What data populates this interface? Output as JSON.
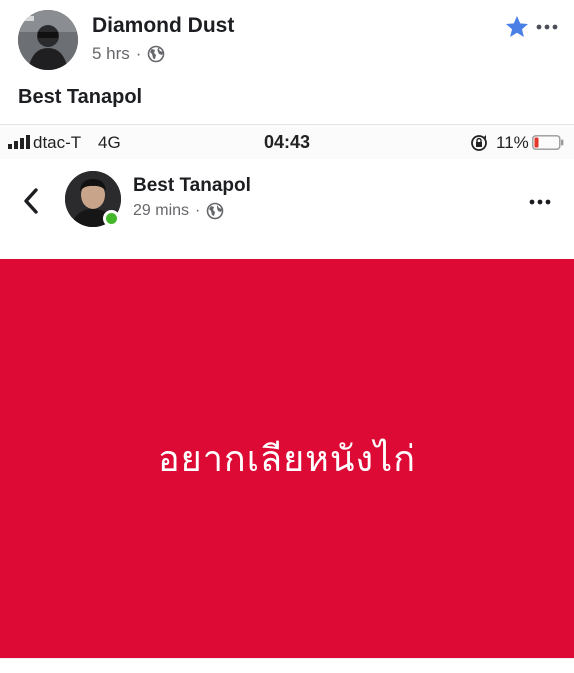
{
  "post": {
    "author": "Diamond Dust",
    "time": "5 hrs",
    "separator": "·",
    "text": "Best Tanapol"
  },
  "status_bar": {
    "carrier": "dtac-T",
    "network": "4G",
    "time": "04:43",
    "battery": "11%"
  },
  "inner_post": {
    "author": "Best Tanapol",
    "time": "29 mins",
    "separator": "·",
    "card_text": "อยากเลียหนังไก่"
  },
  "colors": {
    "card_background": "#dd0a35",
    "star": "#4a7fe6",
    "online": "#42b72a",
    "battery_low": "#e5352b"
  },
  "icons": [
    "avatar",
    "globe-icon",
    "star-icon",
    "more-icon",
    "signal-icon",
    "lock-rotation-icon",
    "battery-icon",
    "back-icon"
  ]
}
